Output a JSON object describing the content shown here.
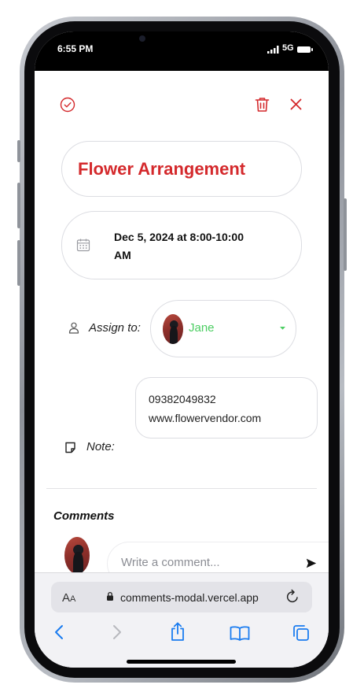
{
  "status_bar": {
    "time": "6:55 PM",
    "network": "5G"
  },
  "header": {
    "complete_icon": "check-circle-icon",
    "delete_icon": "trash-icon",
    "close_icon": "close-icon"
  },
  "event": {
    "title": "Flower Arrangement",
    "date_line1": "Dec 5, 2024 at 8:00-10:00",
    "date_line2": "AM"
  },
  "assign": {
    "label": "Assign to:",
    "name": "Jane"
  },
  "note": {
    "label": "Note:",
    "line1": "09382049832",
    "line2": "www.flowervendor.com"
  },
  "comments": {
    "heading": "Comments",
    "placeholder": "Write a comment..."
  },
  "browser": {
    "text_size_label": "A",
    "text_size_small": "A",
    "url": "comments-modal.vercel.app"
  },
  "colors": {
    "accent_red": "#d4292c",
    "assignee_green": "#4cce62",
    "safari_blue": "#1a7cf0"
  }
}
